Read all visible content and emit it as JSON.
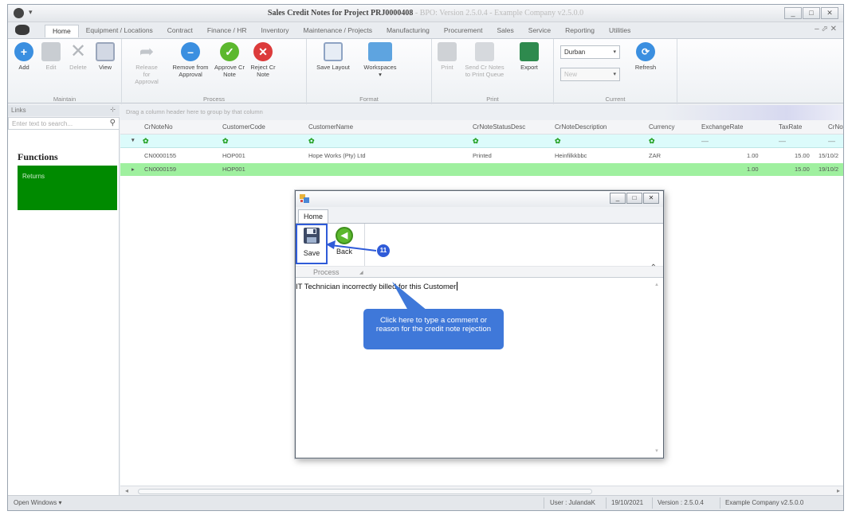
{
  "window": {
    "title_bold": "Sales Credit Notes for Project PRJ0000408",
    "title_rest": " - BPO: Version 2.5.0.4 - Example Company v2.5.0.0",
    "min_glyph": "_",
    "max_glyph": "□",
    "close_glyph": "✕",
    "qat_glyph": "▾"
  },
  "tabs": [
    "Home",
    "Equipment / Locations",
    "Contract",
    "Finance / HR",
    "Inventory",
    "Maintenance / Projects",
    "Manufacturing",
    "Procurement",
    "Sales",
    "Service",
    "Reporting",
    "Utilities"
  ],
  "tabs_right": "–  ⬀  ✕",
  "ribbon": {
    "maintain": {
      "label": "Maintain",
      "add": "Add",
      "edit": "Edit",
      "delete": "Delete",
      "view": "View"
    },
    "process": {
      "label": "Process",
      "release": "Release for Approval",
      "remove": "Remove from Approval",
      "approve": "Approve Cr Note",
      "reject": "Reject Cr Note"
    },
    "format": {
      "label": "Format",
      "save_layout": "Save Layout",
      "workspaces": "Workspaces"
    },
    "print": {
      "label": "Print",
      "print": "Print",
      "send": "Send Cr Notes to Print Queue",
      "export": "Export"
    },
    "current": {
      "label": "Current",
      "site": "Durban",
      "status": "New",
      "refresh": "Refresh"
    }
  },
  "links": {
    "header": "Links",
    "pin": "⊹",
    "search_placeholder": "Enter text to search...",
    "functions": "Functions",
    "returns": "Returns"
  },
  "grid": {
    "group_hint": "Drag a column header here to group by that column",
    "columns": [
      "CrNoteNo",
      "CustomerCode",
      "CustomerName",
      "CrNoteStatusDesc",
      "CrNoteDescription",
      "Currency",
      "ExchangeRate",
      "TaxRate",
      "CrNoteI"
    ],
    "filter_icon": "✿",
    "filter_dash": "—",
    "rows": [
      {
        "no": "CN0000155",
        "code": "HOP001",
        "name": "Hope Works (Pty) Ltd",
        "status": "Printed",
        "desc": "Heinfilkkbbc",
        "cur": "ZAR",
        "rate": "1.00",
        "tax": "15.00",
        "date": "15/10/2"
      },
      {
        "no": "CN0000159",
        "code": "HOP001",
        "name": "",
        "status": "",
        "desc": "",
        "cur": "",
        "rate": "1.00",
        "tax": "15.00",
        "date": "19/10/2"
      }
    ],
    "filter_marker": "▾",
    "row_marker": "▸",
    "scroll_left": "◂",
    "scroll_right": "▸"
  },
  "status": {
    "open_windows": "Open Windows ▾",
    "user": "User : JulandaK",
    "date": "19/10/2021",
    "version": "Version : 2.5.0.4",
    "company": "Example Company v2.5.0.0"
  },
  "dialog": {
    "tab": "Home",
    "save": "Save",
    "back": "Back",
    "process": "Process",
    "text": "IT Technician incorrectly billed for this Customer",
    "min_glyph": "_",
    "max_glyph": "□",
    "close_glyph": "✕",
    "collapse_glyph": "⌃",
    "corner_glyph": "◢",
    "scroll_up": "▲",
    "scroll_down": "▼"
  },
  "annotation": {
    "step": "11",
    "callout": "Click here to type a comment or reason for the credit note rejection"
  },
  "colors": {
    "accent_blue": "#2f5bd8",
    "callout_blue": "#3f78d9",
    "returns_green": "#008a00",
    "selected_row": "#9ff09f",
    "filter_row": "#dcfbfb"
  }
}
